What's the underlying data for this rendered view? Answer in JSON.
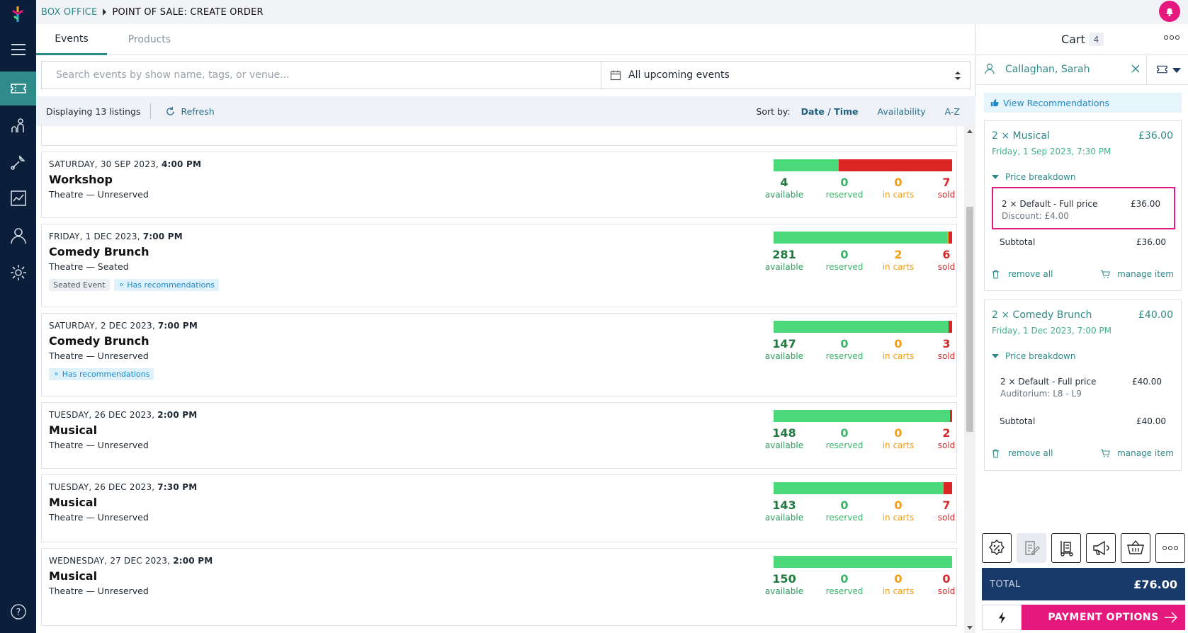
{
  "breadcrumb": {
    "section": "BOX OFFICE",
    "page": "POINT OF SALE: CREATE ORDER"
  },
  "tabs": [
    {
      "label": "Events"
    },
    {
      "label": "Products"
    }
  ],
  "search": {
    "placeholder": "Search events by show name, tags, or venue...",
    "date_filter": "All upcoming events"
  },
  "listbar": {
    "count_text": "Displaying 13 listings",
    "refresh": "Refresh",
    "sort_label": "Sort by:",
    "sort_options": [
      "Date / Time",
      "Availability",
      "A-Z"
    ],
    "active_sort": "Date / Time"
  },
  "events": [
    {
      "date": "SATURDAY, 30 SEP 2023,",
      "time": "4:00 PM",
      "name": "Workshop",
      "venue": "Theatre — Unreserved",
      "tags": [],
      "available": "4",
      "reserved": "0",
      "in_carts": "0",
      "sold": "7"
    },
    {
      "date": "FRIDAY, 1 DEC 2023,",
      "time": "7:00 PM",
      "name": "Comedy Brunch",
      "venue": "Theatre — Seated",
      "tags": [
        "Seated Event",
        "Has recommendations"
      ],
      "available": "281",
      "reserved": "0",
      "in_carts": "2",
      "sold": "6"
    },
    {
      "date": "SATURDAY, 2 DEC 2023,",
      "time": "7:00 PM",
      "name": "Comedy Brunch",
      "venue": "Theatre — Unreserved",
      "tags": [
        "Has recommendations"
      ],
      "available": "147",
      "reserved": "0",
      "in_carts": "0",
      "sold": "3"
    },
    {
      "date": "TUESDAY, 26 DEC 2023,",
      "time": "2:00 PM",
      "name": "Musical",
      "venue": "Theatre — Unreserved",
      "tags": [],
      "available": "148",
      "reserved": "0",
      "in_carts": "0",
      "sold": "2"
    },
    {
      "date": "TUESDAY, 26 DEC 2023,",
      "time": "7:30 PM",
      "name": "Musical",
      "venue": "Theatre — Unreserved",
      "tags": [],
      "available": "143",
      "reserved": "0",
      "in_carts": "0",
      "sold": "7"
    },
    {
      "date": "WEDNESDAY, 27 DEC 2023,",
      "time": "2:00 PM",
      "name": "Musical",
      "venue": "Theatre — Unreserved",
      "tags": [],
      "available": "150",
      "reserved": "0",
      "in_carts": "0",
      "sold": "0"
    }
  ],
  "stat_labels": {
    "available": "available",
    "reserved": "reserved",
    "in_carts": "in carts",
    "sold": "sold"
  },
  "cart": {
    "title": "Cart",
    "count": "4",
    "customer": "Callaghan, Sarah",
    "recommendations": "View Recommendations",
    "items": [
      {
        "title": "2 × Musical",
        "price": "£36.00",
        "date": "Friday, 1 Sep 2023, 7:30 PM",
        "breakdown_label": "Price breakdown",
        "line_name": "2 × Default - Full price",
        "line_price": "£36.00",
        "line_sub": "Discount: £4.00",
        "subtotal_label": "Subtotal",
        "subtotal": "£36.00",
        "remove": "remove all",
        "manage": "manage item"
      },
      {
        "title": "2 × Comedy Brunch",
        "price": "£40.00",
        "date": "Friday, 1 Dec 2023, 7:00 PM",
        "breakdown_label": "Price breakdown",
        "line_name": "2 × Default - Full price",
        "line_price": "£40.00",
        "line_sub": "Auditorium: L8 - L9",
        "subtotal_label": "Subtotal",
        "subtotal": "£40.00",
        "remove": "remove all",
        "manage": "manage item"
      }
    ],
    "total_label": "TOTAL",
    "total": "£76.00",
    "payment_button": "PAYMENT OPTIONS"
  },
  "colors": {
    "brand_teal": "#2d8a88",
    "sidebar": "#0b1f3a",
    "pink": "#e5197d",
    "total_bg": "#183a6b",
    "available_bar": "#4cd97b",
    "sold_bar": "#dc2626"
  },
  "bar_fractions": [
    {
      "available": 0.364,
      "in_carts": 0,
      "sold": 0.636
    },
    {
      "available": 0.972,
      "in_carts": 0.007,
      "sold": 0.021
    },
    {
      "available": 0.98,
      "in_carts": 0,
      "sold": 0.02
    },
    {
      "available": 0.987,
      "in_carts": 0,
      "sold": 0.013
    },
    {
      "available": 0.953,
      "in_carts": 0,
      "sold": 0.047
    },
    {
      "available": 1.0,
      "in_carts": 0,
      "sold": 0
    }
  ]
}
